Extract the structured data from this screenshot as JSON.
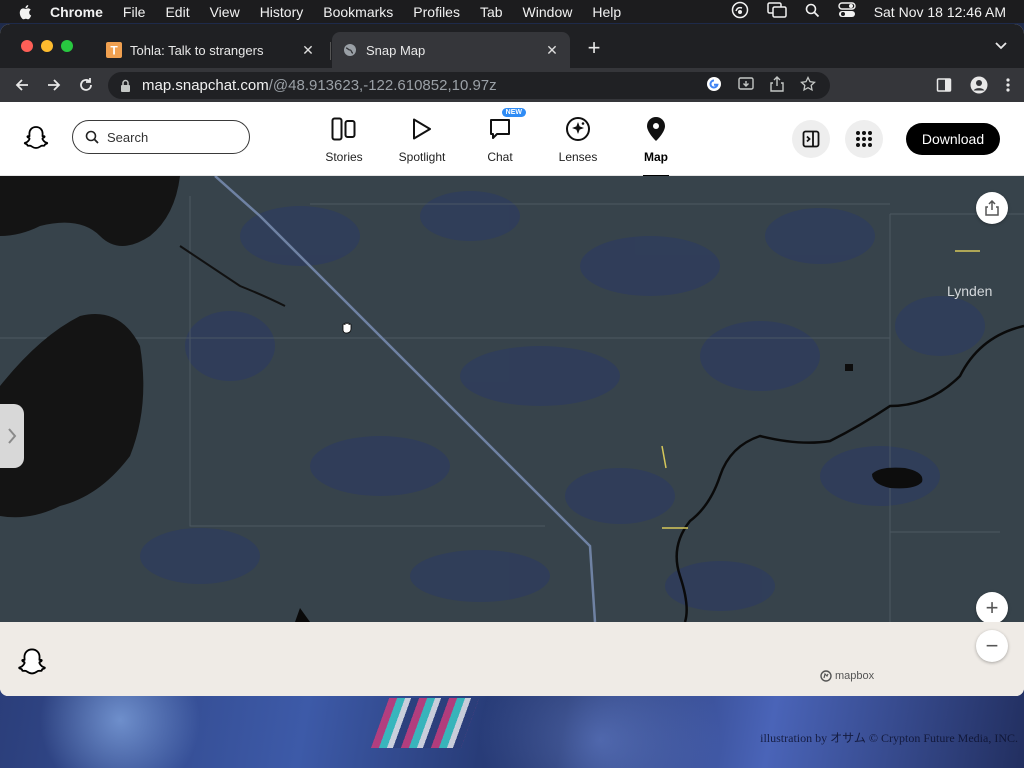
{
  "menubar": {
    "app_name": "Chrome",
    "items": [
      "File",
      "Edit",
      "View",
      "History",
      "Bookmarks",
      "Profiles",
      "Tab",
      "Window",
      "Help"
    ],
    "clock": "Sat Nov 18  12:46 AM"
  },
  "browser": {
    "tabs": [
      {
        "title": "Tohla: Talk to strangers",
        "favicon": "T",
        "active": false
      },
      {
        "title": "Snap Map",
        "favicon": "globe-icon",
        "active": true
      }
    ],
    "url_domain": "map.snapchat.com",
    "url_path": "/@48.913623,-122.610852,10.97z"
  },
  "snapchat": {
    "search_placeholder": "Search",
    "nav": [
      {
        "label": "Stories",
        "icon": "stories-icon",
        "active": false
      },
      {
        "label": "Spotlight",
        "icon": "spotlight-play-icon",
        "active": false
      },
      {
        "label": "Chat",
        "icon": "chat-icon",
        "active": false,
        "badge": "NEW"
      },
      {
        "label": "Lenses",
        "icon": "lenses-icon",
        "active": false
      },
      {
        "label": "Map",
        "icon": "map-pin-icon",
        "active": true
      }
    ],
    "download_label": "Download"
  },
  "map": {
    "place_label": "Lynden",
    "zoom_in": "+",
    "zoom_out": "−",
    "attribution": "mapbox"
  },
  "wallpaper": {
    "credit": "illustration by オサム © Crypton Future Media, INC."
  },
  "colors": {
    "map_land": "#37434b",
    "map_patch": "#2f3d5c",
    "nav_badge": "#2f8cf5",
    "download_bg": "#000000"
  }
}
